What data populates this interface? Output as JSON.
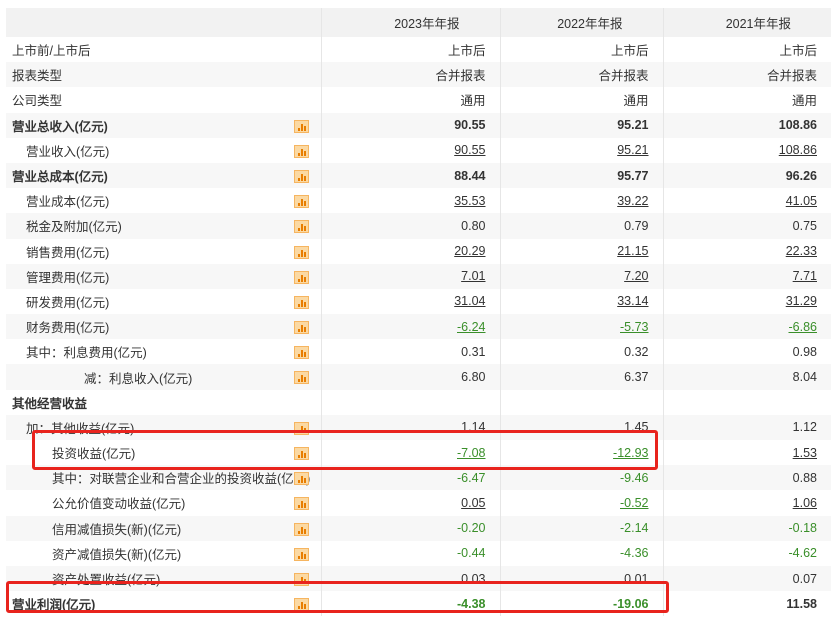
{
  "columns": [
    "",
    "2023年年报",
    "2022年年报",
    "2021年年报"
  ],
  "rows": [
    {
      "label": "上市前/上市后",
      "v": [
        "上市后",
        "上市后",
        "上市后"
      ]
    },
    {
      "label": "报表类型",
      "v": [
        "合并报表",
        "合并报表",
        "合并报表"
      ]
    },
    {
      "label": "公司类型",
      "v": [
        "通用",
        "通用",
        "通用"
      ]
    },
    {
      "label": "营业总收入(亿元)",
      "v": [
        "90.55",
        "95.21",
        "108.86"
      ],
      "bold": true,
      "chart": true
    },
    {
      "label": "营业收入(亿元)",
      "v": [
        "90.55",
        "95.21",
        "108.86"
      ],
      "indent": 1,
      "chart": true,
      "u": true
    },
    {
      "label": "营业总成本(亿元)",
      "v": [
        "88.44",
        "95.77",
        "96.26"
      ],
      "bold": true,
      "chart": true
    },
    {
      "label": "营业成本(亿元)",
      "v": [
        "35.53",
        "39.22",
        "41.05"
      ],
      "indent": 1,
      "chart": true,
      "u": true
    },
    {
      "label": "税金及附加(亿元)",
      "v": [
        "0.80",
        "0.79",
        "0.75"
      ],
      "indent": 1,
      "chart": true
    },
    {
      "label": "销售费用(亿元)",
      "v": [
        "20.29",
        "21.15",
        "22.33"
      ],
      "indent": 1,
      "chart": true,
      "u": true
    },
    {
      "label": "管理费用(亿元)",
      "v": [
        "7.01",
        "7.20",
        "7.71"
      ],
      "indent": 1,
      "chart": true,
      "u": true
    },
    {
      "label": "研发费用(亿元)",
      "v": [
        "31.04",
        "33.14",
        "31.29"
      ],
      "indent": 1,
      "chart": true,
      "u": true
    },
    {
      "label": "财务费用(亿元)",
      "v": [
        "-6.24",
        "-5.73",
        "-6.86"
      ],
      "indent": 1,
      "chart": true,
      "u": true
    },
    {
      "label": "其中：利息费用(亿元)",
      "v": [
        "0.31",
        "0.32",
        "0.98"
      ],
      "indent": 1,
      "chart": true
    },
    {
      "label": "减：利息收入(亿元)",
      "v": [
        "6.80",
        "6.37",
        "8.04"
      ],
      "indent": 3,
      "chart": true
    },
    {
      "label": "其他经营收益",
      "v": [
        "",
        "",
        ""
      ],
      "bold": true
    },
    {
      "label": "加：其他收益(亿元)",
      "v": [
        "1.14",
        "1.45",
        "1.12"
      ],
      "indent": 1,
      "chart": true
    },
    {
      "label": "投资收益(亿元)",
      "v": [
        "-7.08",
        "-12.93",
        "1.53"
      ],
      "indent": 2,
      "chart": true,
      "u": true
    },
    {
      "label": "其中：对联营企业和合营企业的投资收益(亿元)",
      "v": [
        "-6.47",
        "-9.46",
        "0.88"
      ],
      "indent": 2,
      "chart": true
    },
    {
      "label": "公允价值变动收益(亿元)",
      "v": [
        "0.05",
        "-0.52",
        "1.06"
      ],
      "indent": 2,
      "chart": true,
      "u": true
    },
    {
      "label": "信用减值损失(新)(亿元)",
      "v": [
        "-0.20",
        "-2.14",
        "-0.18"
      ],
      "indent": 2,
      "chart": true
    },
    {
      "label": "资产减值损失(新)(亿元)",
      "v": [
        "-0.44",
        "-4.36",
        "-4.62"
      ],
      "indent": 2,
      "chart": true
    },
    {
      "label": "资产处置收益(亿元)",
      "v": [
        "0.03",
        "0.01",
        "0.07"
      ],
      "indent": 2,
      "chart": true
    },
    {
      "label": "营业利润(亿元)",
      "v": [
        "-4.38",
        "-19.06",
        "11.58"
      ],
      "bold": true,
      "chart": true
    }
  ],
  "highlight_color": "#e8231d",
  "negative_color": "#3a8f2a"
}
